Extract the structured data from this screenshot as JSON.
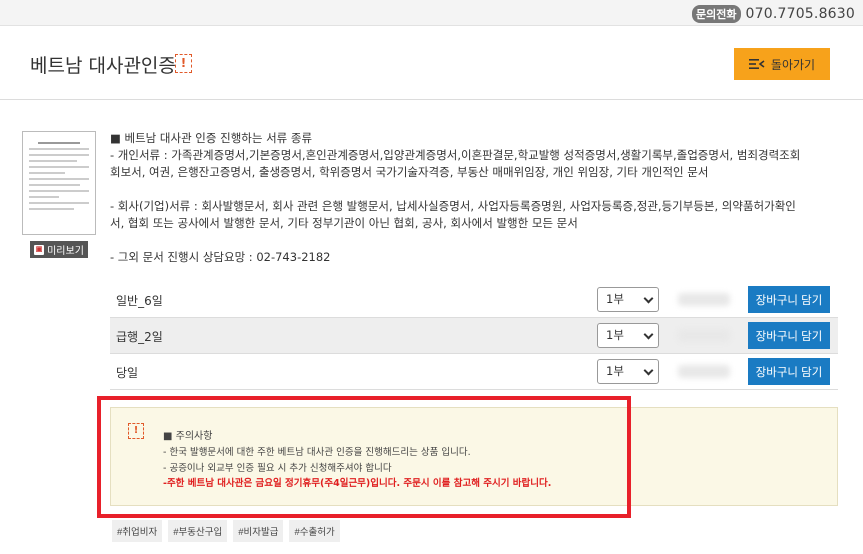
{
  "topbar": {
    "phone_label": "문의전화",
    "phone_number": "070.7705.8630"
  },
  "header": {
    "title": "베트남 대사관인증",
    "alert_icon": "!",
    "back_label": "돌아가기"
  },
  "preview": {
    "label": "미리보기"
  },
  "description": {
    "text": "■ 베트남 대사관 인증 진행하는 서류 종류\n- 개인서류 : 가족관계증명서,기본증명서,혼인관계증명서,입양관계증명서,이혼판결문,학교발행 성적증명서,생활기록부,졸업증명서, 범죄경력조회회보서, 여권, 은행잔고증명서, 출생증명서, 학위증명서 국가기술자격증, 부동산 매매위임장, 개인 위임장, 기타 개인적인 문서\n\n- 회사(기업)서류 : 회사발행문서, 회사 관련 은행 발행문서, 납세사실증명서, 사업자등록증명원, 사업자등록증,정관,등기부등본, 의약품허가확인서, 협회 또는 공사에서 발행한 문서, 기타 정부기관이 아닌 협회, 공사, 회사에서 발행한 모든 문서\n\n- 그외 문서 진행시 상담요망 : 02-743-2182"
  },
  "options": [
    {
      "name": "일반_6일",
      "qty": "1부",
      "cart_label": "장바구니 담기"
    },
    {
      "name": "급행_2일",
      "qty": "1부",
      "cart_label": "장바구니 담기"
    },
    {
      "name": "당일",
      "qty": "1부",
      "cart_label": "장바구니 담기"
    }
  ],
  "notice": {
    "icon": "!",
    "title": "■ 주의사항",
    "lines": [
      "- 한국 발행문서에 대한 주한 베트남 대사관 인증을 진행해드리는 상품 입니다.",
      "- 공증이나 외교부 인증 필요 시 추가 신청해주셔야 합니다"
    ],
    "warning": "-주한 베트남 대사관은 금요일 정기휴무(주4일근무)입니다. 주문시 이를 참고해 주시기 바랍니다."
  },
  "tags": [
    "#취업비자",
    "#부동산구입",
    "#비자발급",
    "#수출허가"
  ],
  "colors": {
    "accent_button": "#f7a21b",
    "cart_button": "#1a7bc3",
    "highlight_box": "#e8202a",
    "warning_text": "#e02020"
  }
}
